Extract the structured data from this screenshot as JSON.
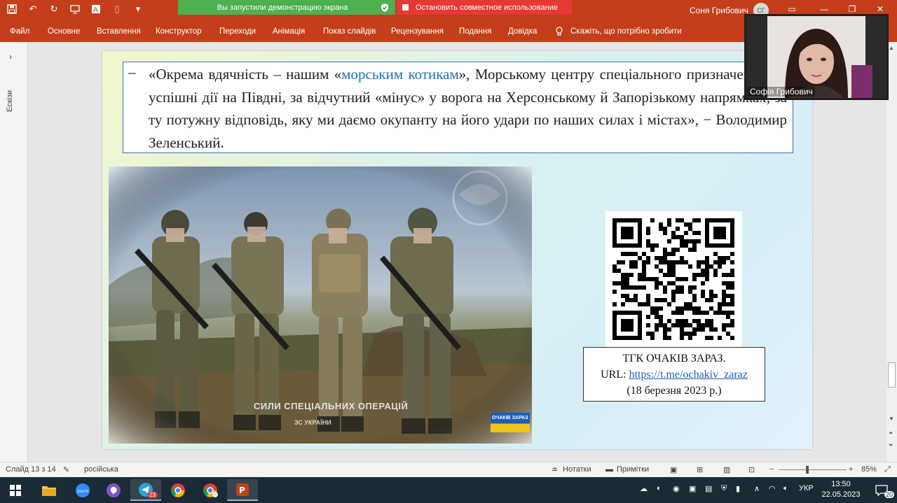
{
  "titlebar": {
    "share_status": "Вы запустили демонстрацию экрана",
    "stop_share": "Остановить совместное использование",
    "user_name": "Соня Грибович",
    "user_initials": "СГ"
  },
  "ribbon": {
    "tabs": [
      "Файл",
      "Основне",
      "Вставлення",
      "Конструктор",
      "Переходи",
      "Анімація",
      "Показ слайдів",
      "Рецензування",
      "Подання",
      "Довідка"
    ],
    "tell_me": "Скажіть, що потрібно зробити"
  },
  "leftpane": {
    "label": "Ескізи"
  },
  "slide": {
    "quote_dash": "–",
    "quote_before": "«Окрема вдячність – нашим «",
    "quote_highlight": "морським котикам",
    "quote_after": "», Морському центру спеціального призначення, за успішні дії на Півдні, за відчутний «мінус» у ворога на Херсонському й Запорізькому напрямках, за ту потужну відповідь, яку ми даємо окупанту на його удари по наших силах і містах», − Володимир Зеленський.",
    "photo_caption": "СИЛИ СПЕЦІАЛЬНИХ ОПЕРАЦІЙ",
    "photo_subcaption": "ЗС УКРАЇНИ",
    "photo_badge": "ОЧАКІВ ЗАРАЗ",
    "qr_line1": "ТГК ОЧАКІВ ЗАРАЗ.",
    "qr_url_label": "URL: ",
    "qr_url": "https://t.me/ochakiv_zaraz",
    "qr_date": "(18 березня 2023 р.)"
  },
  "webcam": {
    "name": "Софія Грибович"
  },
  "statusbar": {
    "slide_info": "Слайд 13 з 14",
    "language": "російська",
    "notes": "Нотатки",
    "comments": "Примітки",
    "zoom": "85%"
  },
  "taskbar": {
    "telegram_badge": "23",
    "tray_lang": "УКР",
    "time": "13:50",
    "date": "22.05.2023",
    "notification_count": "20"
  },
  "colors": {
    "ribbon": "#c43e1c",
    "share_green": "#4caf50",
    "share_red": "#e53935",
    "link": "#1f73b7"
  }
}
